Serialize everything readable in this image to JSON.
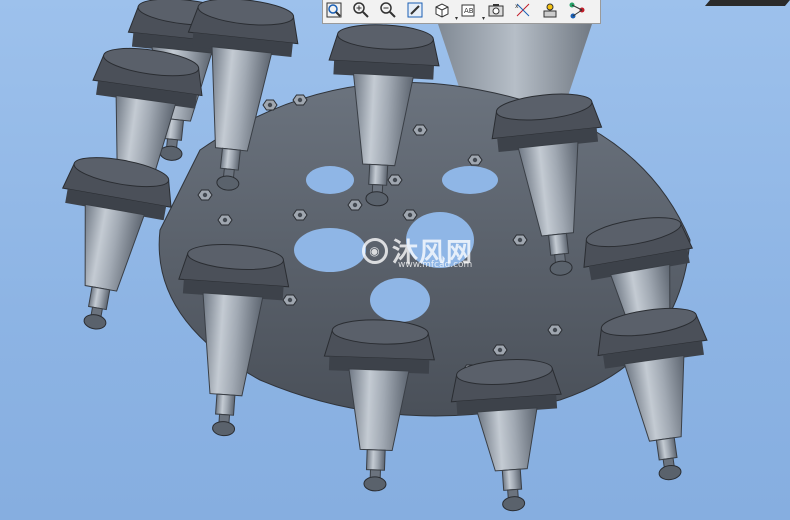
{
  "toolbar": {
    "buttons": [
      {
        "name": "zoom-to-fit",
        "icon": "zoom-fit-icon"
      },
      {
        "name": "zoom-in",
        "icon": "zoom-in-icon"
      },
      {
        "name": "zoom-out",
        "icon": "zoom-out-icon"
      },
      {
        "name": "sketch",
        "icon": "pencil-sketch-icon"
      },
      {
        "name": "view-orientation",
        "icon": "cube-view-icon"
      },
      {
        "name": "annotation-display",
        "icon": "annotation-ab-icon"
      },
      {
        "name": "camera-render",
        "icon": "camera-icon"
      },
      {
        "name": "coordinate-axes",
        "icon": "axes-xyz-icon"
      },
      {
        "name": "scene-lighting",
        "icon": "scene-icon"
      },
      {
        "name": "relations",
        "icon": "relations-icon"
      }
    ]
  },
  "watermark": {
    "text": "沐风网",
    "url": "www.mfcad.com"
  },
  "colors": {
    "background": "#8fb6e6",
    "holder_body": "#9aa3ad",
    "flange": "#4f5560",
    "plate": "#5e6570"
  }
}
